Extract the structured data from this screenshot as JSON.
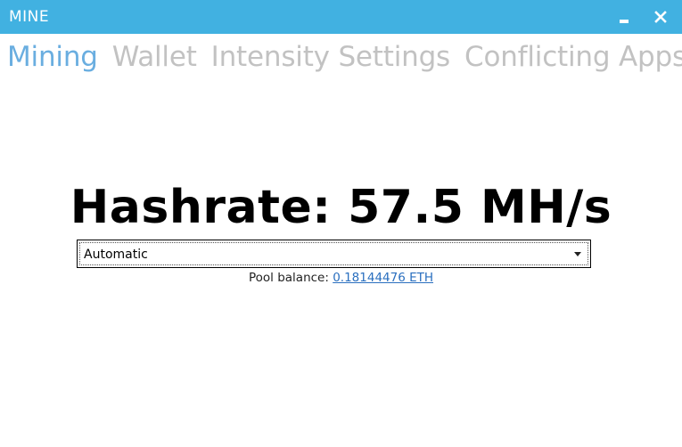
{
  "window": {
    "title": "MINE",
    "accent_color": "#41b1e1",
    "controls": {
      "minimize_icon": "minimize-icon",
      "close_icon": "close-icon"
    }
  },
  "tabs": [
    {
      "label": "Mining",
      "active": true
    },
    {
      "label": "Wallet",
      "active": false
    },
    {
      "label": "Intensity Settings",
      "active": false
    },
    {
      "label": "Conflicting Apps",
      "active": false
    }
  ],
  "main": {
    "hashrate_text": "Hashrate: 57.5 MH/s",
    "mode_select": {
      "selected": "Automatic"
    },
    "pool_balance": {
      "label": "Pool balance:",
      "value": "0.18144476 ETH"
    }
  }
}
